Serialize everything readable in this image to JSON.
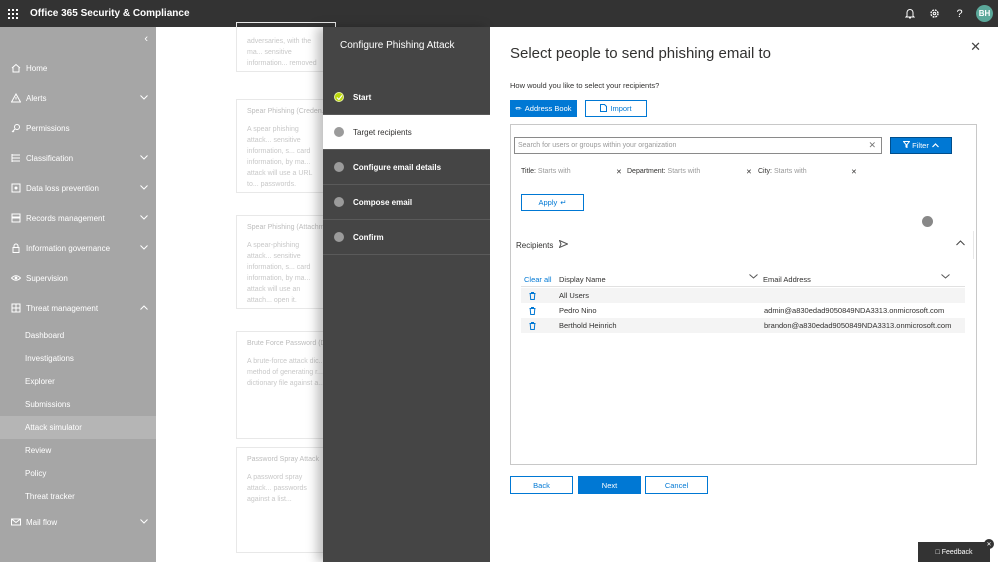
{
  "app": {
    "title": "Office 365 Security & Compliance",
    "user_initials": "BH"
  },
  "topbar_icons": [
    "bell-icon",
    "gear-icon",
    "help-icon"
  ],
  "nav": {
    "items": [
      {
        "label": "Home",
        "icon": "home-icon",
        "expandable": false
      },
      {
        "label": "Alerts",
        "icon": "alert-icon",
        "expandable": true
      },
      {
        "label": "Permissions",
        "icon": "permissions-icon",
        "expandable": false
      },
      {
        "label": "Classification",
        "icon": "classification-icon",
        "expandable": true
      },
      {
        "label": "Data loss prevention",
        "icon": "dlp-icon",
        "expandable": true
      },
      {
        "label": "Records management",
        "icon": "records-icon",
        "expandable": true
      },
      {
        "label": "Information governance",
        "icon": "lock-icon",
        "expandable": true
      },
      {
        "label": "Supervision",
        "icon": "eye-icon",
        "expandable": false
      },
      {
        "label": "Threat management",
        "icon": "threat-icon",
        "expandable": true,
        "expanded": true
      }
    ],
    "threat_subitems": [
      "Dashboard",
      "Investigations",
      "Explorer",
      "Submissions",
      "Attack simulator",
      "Review",
      "Policy",
      "Threat tracker"
    ],
    "active_subitem": "Attack simulator",
    "mail_flow": "Mail flow"
  },
  "background_cards": [
    {
      "title": "",
      "text": "adversaries, with the ma... sensitive information... removed and replaced... experiences, then relay... recipient."
    },
    {
      "title": "Spear Phishing (Creden...",
      "text": "A spear phishing attack... sensitive information, s... card information, by ma... attack will use a URL to... passwords."
    },
    {
      "title": "Spear Phishing (Attachm...",
      "text": "A spear-phishing attack... sensitive information, s... card information, by ma... attack will use an attach... open it."
    },
    {
      "title": "Brute Force Password (D...",
      "text": "A brute-force attack dic... method of generating r... dictionary file against a..."
    },
    {
      "title": "Password Spray Attack",
      "text": "A password spray attack... passwords against a list..."
    }
  ],
  "wizard": {
    "title": "Configure Phishing Attack",
    "steps": [
      {
        "label": "Start",
        "state": "done"
      },
      {
        "label": "Target recipients",
        "state": "current"
      },
      {
        "label": "Configure email details",
        "state": "pending"
      },
      {
        "label": "Compose email",
        "state": "pending"
      },
      {
        "label": "Confirm",
        "state": "pending"
      }
    ]
  },
  "main": {
    "title": "Select people to send phishing email to",
    "question": "How would you like to select your recipients?",
    "address_book_label": "Address Book",
    "import_label": "Import",
    "search_placeholder": "Search for users or groups within your organization",
    "filter_label": "Filter",
    "filters": [
      {
        "label": "Title:",
        "placeholder": "Starts with"
      },
      {
        "label": "Department:",
        "placeholder": "Starts with"
      },
      {
        "label": "City:",
        "placeholder": "Starts with"
      }
    ],
    "apply_label": "Apply",
    "recipients_label": "Recipients",
    "columns": {
      "clear_all": "Clear all",
      "display_name": "Display Name",
      "email": "Email Address"
    },
    "rows": [
      {
        "name": "All Users",
        "email": ""
      },
      {
        "name": "Pedro Nino",
        "email": "admin@a830edad9050849NDA3313.onmicrosoft.com"
      },
      {
        "name": "Berthold Heinrich",
        "email": "brandon@a830edad9050849NDA3313.onmicrosoft.com"
      }
    ],
    "back_label": "Back",
    "next_label": "Next",
    "cancel_label": "Cancel"
  },
  "feedback_label": "Feedback",
  "colors": {
    "accent": "#0078d4",
    "topbar": "#333333",
    "nav_bg": "#a6a6a6",
    "wizard_bg": "#454545",
    "done_step": "#bad80a"
  }
}
